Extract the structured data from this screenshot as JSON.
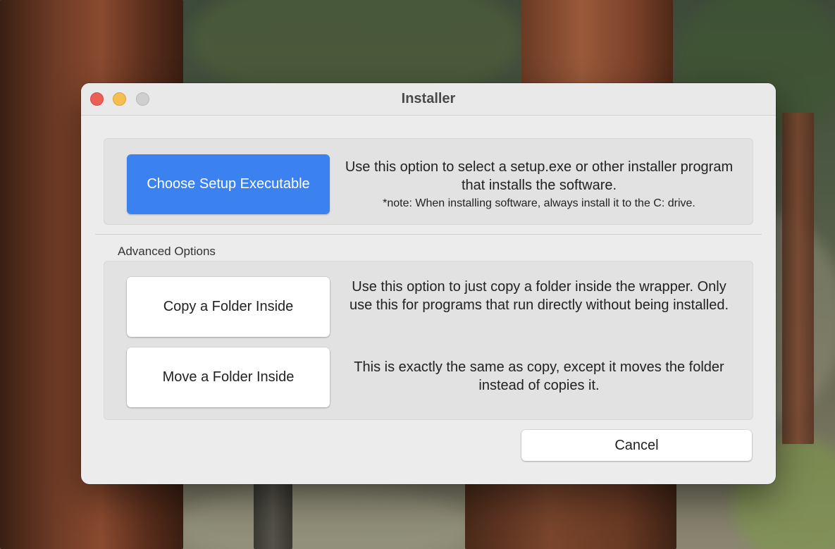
{
  "window": {
    "title": "Installer"
  },
  "setup": {
    "button_label": "Choose Setup Executable",
    "description": "Use this option to select a setup.exe or other installer program that installs the software.",
    "note": "*note: When installing software, always install it to the C: drive."
  },
  "advanced": {
    "section_label": "Advanced Options",
    "copy": {
      "button_label": "Copy a Folder Inside",
      "description": "Use this option to just copy a folder inside the wrapper. Only use this for programs that run directly without being installed."
    },
    "move": {
      "button_label": "Move a Folder Inside",
      "description": "This is exactly the same as copy, except it moves the folder instead of copies it."
    }
  },
  "footer": {
    "cancel_label": "Cancel"
  },
  "colors": {
    "primary_button": "#3b82f0",
    "close": "#ec5f56",
    "minimize": "#f4bf4f",
    "zoom_disabled": "#cfcfcf"
  }
}
